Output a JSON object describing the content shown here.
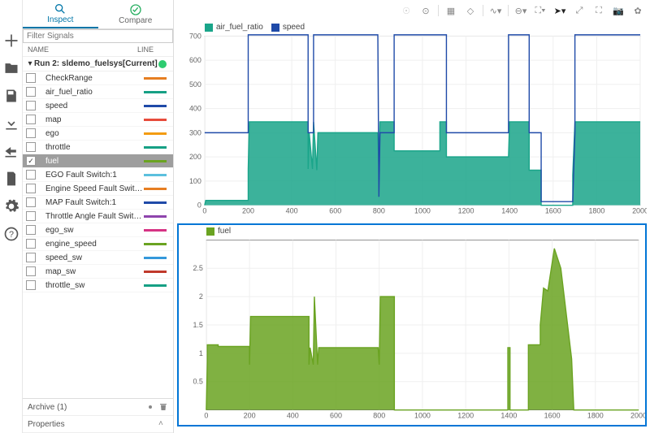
{
  "tabs": {
    "inspect": "Inspect",
    "compare": "Compare"
  },
  "filter_placeholder": "Filter Signals",
  "columns": {
    "name": "NAME",
    "line": "LINE"
  },
  "run": {
    "label": "Run 2: sldemo_fuelsys[Current]",
    "indicator": "#2ecc71"
  },
  "signals": [
    {
      "name": "CheckRange",
      "color": "#e67e22",
      "checked": false
    },
    {
      "name": "air_fuel_ratio",
      "color": "#16a085",
      "checked": false
    },
    {
      "name": "speed",
      "color": "#1f4aa8",
      "checked": false
    },
    {
      "name": "map",
      "color": "#e74c3c",
      "checked": false
    },
    {
      "name": "ego",
      "color": "#f39c12",
      "checked": false
    },
    {
      "name": "throttle",
      "color": "#16a085",
      "checked": false
    },
    {
      "name": "fuel",
      "color": "#6aa321",
      "checked": true,
      "selected": true
    },
    {
      "name": "EGO Fault Switch:1",
      "color": "#5bc0de",
      "checked": false
    },
    {
      "name": "Engine Speed Fault Switch:1",
      "color": "#e67e22",
      "checked": false
    },
    {
      "name": "MAP Fault Switch:1",
      "color": "#1f4aa8",
      "checked": false
    },
    {
      "name": "Throttle Angle Fault Switch:1",
      "color": "#8e44ad",
      "checked": false
    },
    {
      "name": "ego_sw",
      "color": "#d63384",
      "checked": false
    },
    {
      "name": "engine_speed",
      "color": "#6aa321",
      "checked": false
    },
    {
      "name": "speed_sw",
      "color": "#3498db",
      "checked": false
    },
    {
      "name": "map_sw",
      "color": "#c0392b",
      "checked": false
    },
    {
      "name": "throttle_sw",
      "color": "#16a085",
      "checked": false
    }
  ],
  "archive_label": "Archive (1)",
  "properties_label": "Properties",
  "chart_data": [
    {
      "type": "area",
      "title": "",
      "xlabel": "",
      "ylabel": "",
      "xlim": [
        0,
        2000
      ],
      "ylim": [
        0,
        700
      ],
      "xticks": [
        0,
        200,
        400,
        600,
        800,
        1000,
        1200,
        1400,
        1600,
        1800,
        2000
      ],
      "yticks": [
        0,
        100,
        200,
        300,
        400,
        500,
        600,
        700
      ],
      "series": [
        {
          "name": "air_fuel_ratio",
          "color": "#1aa58a",
          "fill": true,
          "points": [
            [
              0,
              0
            ],
            [
              5,
              20
            ],
            [
              200,
              20
            ],
            [
              200,
              150
            ],
            [
              205,
              345
            ],
            [
              475,
              345
            ],
            [
              475,
              150
            ],
            [
              480,
              300
            ],
            [
              495,
              150
            ],
            [
              500,
              345
            ],
            [
              515,
              145
            ],
            [
              520,
              300
            ],
            [
              795,
              300
            ],
            [
              800,
              145
            ],
            [
              805,
              345
            ],
            [
              870,
              345
            ],
            [
              870,
              225
            ],
            [
              1080,
              225
            ],
            [
              1080,
              345
            ],
            [
              1110,
              345
            ],
            [
              1110,
              200
            ],
            [
              1395,
              200
            ],
            [
              1400,
              345
            ],
            [
              1490,
              345
            ],
            [
              1490,
              145
            ],
            [
              1545,
              145
            ],
            [
              1545,
              0
            ],
            [
              1690,
              0
            ],
            [
              1690,
              125
            ],
            [
              1700,
              345
            ],
            [
              2000,
              345
            ]
          ]
        },
        {
          "name": "speed",
          "color": "#1f4aa8",
          "fill": false,
          "points": [
            [
              0,
              300
            ],
            [
              200,
              300
            ],
            [
              200,
              705
            ],
            [
              475,
              705
            ],
            [
              475,
              300
            ],
            [
              500,
              300
            ],
            [
              500,
              705
            ],
            [
              795,
              705
            ],
            [
              800,
              35
            ],
            [
              805,
              300
            ],
            [
              870,
              300
            ],
            [
              870,
              705
            ],
            [
              1110,
              705
            ],
            [
              1110,
              300
            ],
            [
              1395,
              300
            ],
            [
              1395,
              705
            ],
            [
              1490,
              705
            ],
            [
              1490,
              300
            ],
            [
              1545,
              300
            ],
            [
              1545,
              15
            ],
            [
              1690,
              15
            ],
            [
              1690,
              20
            ],
            [
              1700,
              300
            ],
            [
              1700,
              705
            ],
            [
              2000,
              705
            ]
          ]
        }
      ]
    },
    {
      "type": "area",
      "title": "",
      "xlabel": "",
      "ylabel": "",
      "xlim": [
        0,
        2000
      ],
      "ylim": [
        0,
        3.0
      ],
      "xticks": [
        0,
        200,
        400,
        600,
        800,
        1000,
        1200,
        1400,
        1600,
        1800,
        2000
      ],
      "yticks": [
        0.5,
        1.0,
        1.5,
        2.0,
        2.5
      ],
      "series": [
        {
          "name": "fuel",
          "color": "#6aa321",
          "fill": true,
          "points": [
            [
              0,
              0
            ],
            [
              5,
              0.85
            ],
            [
              5,
              1.15
            ],
            [
              55,
              1.15
            ],
            [
              55,
              1.12
            ],
            [
              200,
              1.12
            ],
            [
              200,
              0.8
            ],
            [
              205,
              1.65
            ],
            [
              475,
              1.65
            ],
            [
              475,
              0.8
            ],
            [
              480,
              1.1
            ],
            [
              495,
              0.8
            ],
            [
              500,
              2.0
            ],
            [
              515,
              0.8
            ],
            [
              520,
              1.1
            ],
            [
              795,
              1.1
            ],
            [
              800,
              0.8
            ],
            [
              805,
              2.0
            ],
            [
              870,
              2.0
            ],
            [
              870,
              0
            ],
            [
              1395,
              0
            ],
            [
              1395,
              1.1
            ],
            [
              1405,
              1.1
            ],
            [
              1405,
              0
            ],
            [
              1490,
              0
            ],
            [
              1490,
              1.15
            ],
            [
              1545,
              1.15
            ],
            [
              1545,
              1.5
            ],
            [
              1560,
              2.15
            ],
            [
              1580,
              2.1
            ],
            [
              1610,
              2.85
            ],
            [
              1640,
              2.5
            ],
            [
              1690,
              0.9
            ],
            [
              1700,
              0
            ],
            [
              2000,
              0
            ]
          ]
        }
      ]
    }
  ]
}
